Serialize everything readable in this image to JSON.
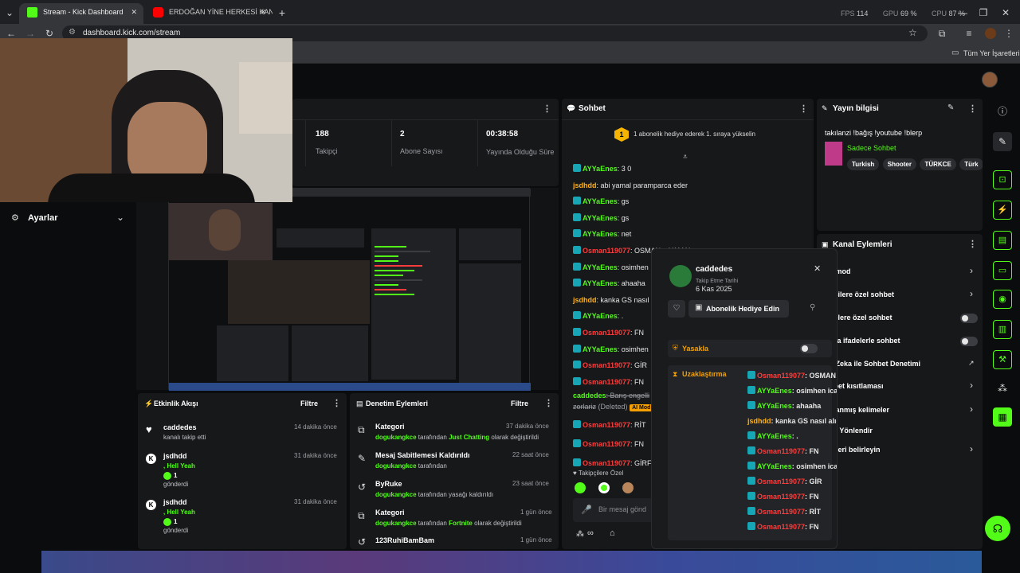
{
  "browser": {
    "tabs": [
      {
        "title": "Stream - Kick Dashboard",
        "active": true
      },
      {
        "title": "ERDOĞAN YİNE HERKESİ KAND",
        "active": false
      }
    ],
    "perf": {
      "fps": "FPS 114",
      "gpu": "GPU 69 %",
      "cpu": "CPU 87 %",
      "fps_label": "FPS",
      "fps_value": "114",
      "gpu_label": "GPU",
      "gpu_value": "69 %",
      "cpu_label": "CPU",
      "cpu_value": "87 %"
    },
    "url": "dashboard.kick.com/stream",
    "bookmarks_label": "Tüm Yer İşaretleri"
  },
  "settings_label": "Ayarlar",
  "stats": [
    {
      "value": "188",
      "label": "Takipçi"
    },
    {
      "value": "2",
      "label": "Abone Sayısı"
    },
    {
      "value": "00:38:58",
      "label": "Yayında Olduğu Süre"
    }
  ],
  "chat": {
    "title": "Sohbet",
    "promo_rank": "1",
    "promo_text": "1 abonelik hediye ederek 1. sıraya yükselin",
    "messages": [
      {
        "user": "AYYaEnes",
        "type": "g",
        "text": ": 3 0"
      },
      {
        "user": "jsdhdd",
        "type": "o",
        "text": ": abi yamal paramparca eder"
      },
      {
        "user": "AYYaEnes",
        "type": "g",
        "text": ": gs"
      },
      {
        "user": "AYYaEnes",
        "type": "g",
        "text": ": gs"
      },
      {
        "user": "AYYaEnes",
        "type": "g",
        "text": ": net"
      },
      {
        "user": "Osman119077",
        "type": "r",
        "text": ": OSMAN > YAMAL"
      },
      {
        "user": "AYYaEnes",
        "type": "g",
        "text": ": osimhen"
      },
      {
        "user": "AYYaEnes",
        "type": "g",
        "text": ": ahaaha"
      },
      {
        "user": "jsdhdd",
        "type": "o",
        "text": ": kanka GS nasıl a"
      },
      {
        "user": "AYYaEnes",
        "type": "g",
        "text": ": ."
      },
      {
        "user": "Osman119077",
        "type": "r",
        "text": ": FN"
      },
      {
        "user": "AYYaEnes",
        "type": "g",
        "text": ": osimhen"
      },
      {
        "user": "Osman119077",
        "type": "r",
        "text": ": GİR"
      },
      {
        "user": "Osman119077",
        "type": "r",
        "text": ": FN"
      }
    ],
    "deleted_user": "caddedes",
    "deleted_text": ": Barış engelli",
    "deleted_text2": "zorlariz",
    "deleted_tag": "(Deleted)",
    "ai_mod": "AI Mod",
    "messages2": [
      {
        "user": "Osman119077",
        "type": "r",
        "text": ": RİT"
      },
      {
        "user": "Osman119077",
        "type": "r",
        "text": ": FN"
      },
      {
        "user": "Osman119077",
        "type": "r",
        "text": ": GİRF"
      }
    ],
    "emote_label": "Takipçilere Özel",
    "input_placeholder": "Bir mesaj gönd",
    "footer_points": "∞"
  },
  "stream_info": {
    "title": "Yayın bilgisi",
    "stream_title": "takılanzi !bağış !youtube !blerp",
    "category": "Sadece Sohbet",
    "tags": [
      "Turkish",
      "Shooter",
      "TÜRKCE",
      "Türk"
    ]
  },
  "channel_actions": {
    "title": "Kanal Eylemleri",
    "items": [
      {
        "label": "ş mod",
        "ctrl": "chevron"
      },
      {
        "label": "pçilere özel sohbet",
        "ctrl": "chevron"
      },
      {
        "label": "nelere özel sohbet",
        "ctrl": "toggle"
      },
      {
        "label": "zca ifadelerle sohbet",
        "ctrl": "toggle"
      },
      {
        "label": "y Zeka ile Sohbet Denetimi",
        "ctrl": "link"
      },
      {
        "label": "hbet kısıtlaması",
        "ctrl": "chevron"
      },
      {
        "label": "klanmış kelimeler",
        "ctrl": "chevron"
      },
      {
        "label": "ici Yönlendir",
        "ctrl": "none"
      },
      {
        "label": "efleri belirleyin",
        "ctrl": "chevron"
      }
    ]
  },
  "user_card": {
    "username": "caddedes",
    "follow_label": "Takip Etme Tarihi",
    "follow_date": "6 Kas 2025",
    "gift_label": "Abonelik Hediye Edin",
    "ban_label": "Yasakla",
    "timeout_label": "Uzaklaştırma",
    "messages": [
      {
        "user": "Osman119077",
        "type": "r",
        "text": ": OSMAN > YAMAL ."
      },
      {
        "user": "AYYaEnes",
        "type": "g",
        "text": ": osimhen icardi"
      },
      {
        "user": "AYYaEnes",
        "type": "g",
        "text": ": ahaaha"
      },
      {
        "user": "jsdhdd",
        "type": "o",
        "text": ": kanka GS nasıl alıcak"
      },
      {
        "user": "AYYaEnes",
        "type": "g",
        "text": ": ."
      },
      {
        "user": "Osman119077",
        "type": "r",
        "text": ": FN"
      },
      {
        "user": "AYYaEnes",
        "type": "g",
        "text": ": osimhen icardi"
      },
      {
        "user": "Osman119077",
        "type": "r",
        "text": ": GİR"
      },
      {
        "user": "Osman119077",
        "type": "r",
        "text": ": FN"
      },
      {
        "user": "Osman119077",
        "type": "r",
        "text": ": RİT"
      },
      {
        "user": "Osman119077",
        "type": "r",
        "text": ": FN"
      }
    ]
  },
  "activity": {
    "title": "Etkinlik Akışı",
    "filter": "Filtre",
    "items": [
      {
        "user": "caddedes",
        "sub": "kanalı takip etti",
        "time": "14 dakika önce",
        "icon": "heart"
      },
      {
        "user": "jsdhdd",
        "sub": ", Hell Yeah",
        "count": "1",
        "sub2": "gönderdi",
        "time": "31 dakika önce",
        "icon": "kick"
      },
      {
        "user": "jsdhdd",
        "sub": ", Hell Yeah",
        "count": "1",
        "sub2": "gönderdi",
        "time": "31 dakika önce",
        "icon": "kick"
      }
    ]
  },
  "moderation": {
    "title": "Denetim Eylemleri",
    "filter": "Filtre",
    "items": [
      {
        "title": "Kategori",
        "user": "dogukangkce",
        "mid": " tarafından ",
        "hl": "Just Chatting",
        "end": " olarak değiştirildi",
        "time": "37 dakika önce",
        "icon": "category"
      },
      {
        "title": "Mesaj Sabitlemesi Kaldırıldı",
        "user": "dogukangkce",
        "mid": " tarafından",
        "hl": "",
        "end": "",
        "time": "22 saat önce",
        "icon": "pin"
      },
      {
        "title": "ByRuke",
        "user": "dogukangkce",
        "mid": " tarafından yasağı kaldırıldı",
        "hl": "",
        "end": "",
        "time": "23 saat önce",
        "icon": "undo"
      },
      {
        "title": "Kategori",
        "user": "dogukangkce",
        "mid": " tarafından ",
        "hl": "Fortnite",
        "end": " olarak değiştirildi",
        "time": "1 gün önce",
        "icon": "category"
      },
      {
        "title": "123RuhiBamBam",
        "user": "",
        "mid": "",
        "hl": "",
        "end": "",
        "time": "1 gün önce",
        "icon": "undo"
      }
    ]
  },
  "colors": {
    "accent": "#53fc18",
    "danger": "#ff3b3b",
    "panel": "#17181a",
    "bg": "#0b0c0d"
  }
}
